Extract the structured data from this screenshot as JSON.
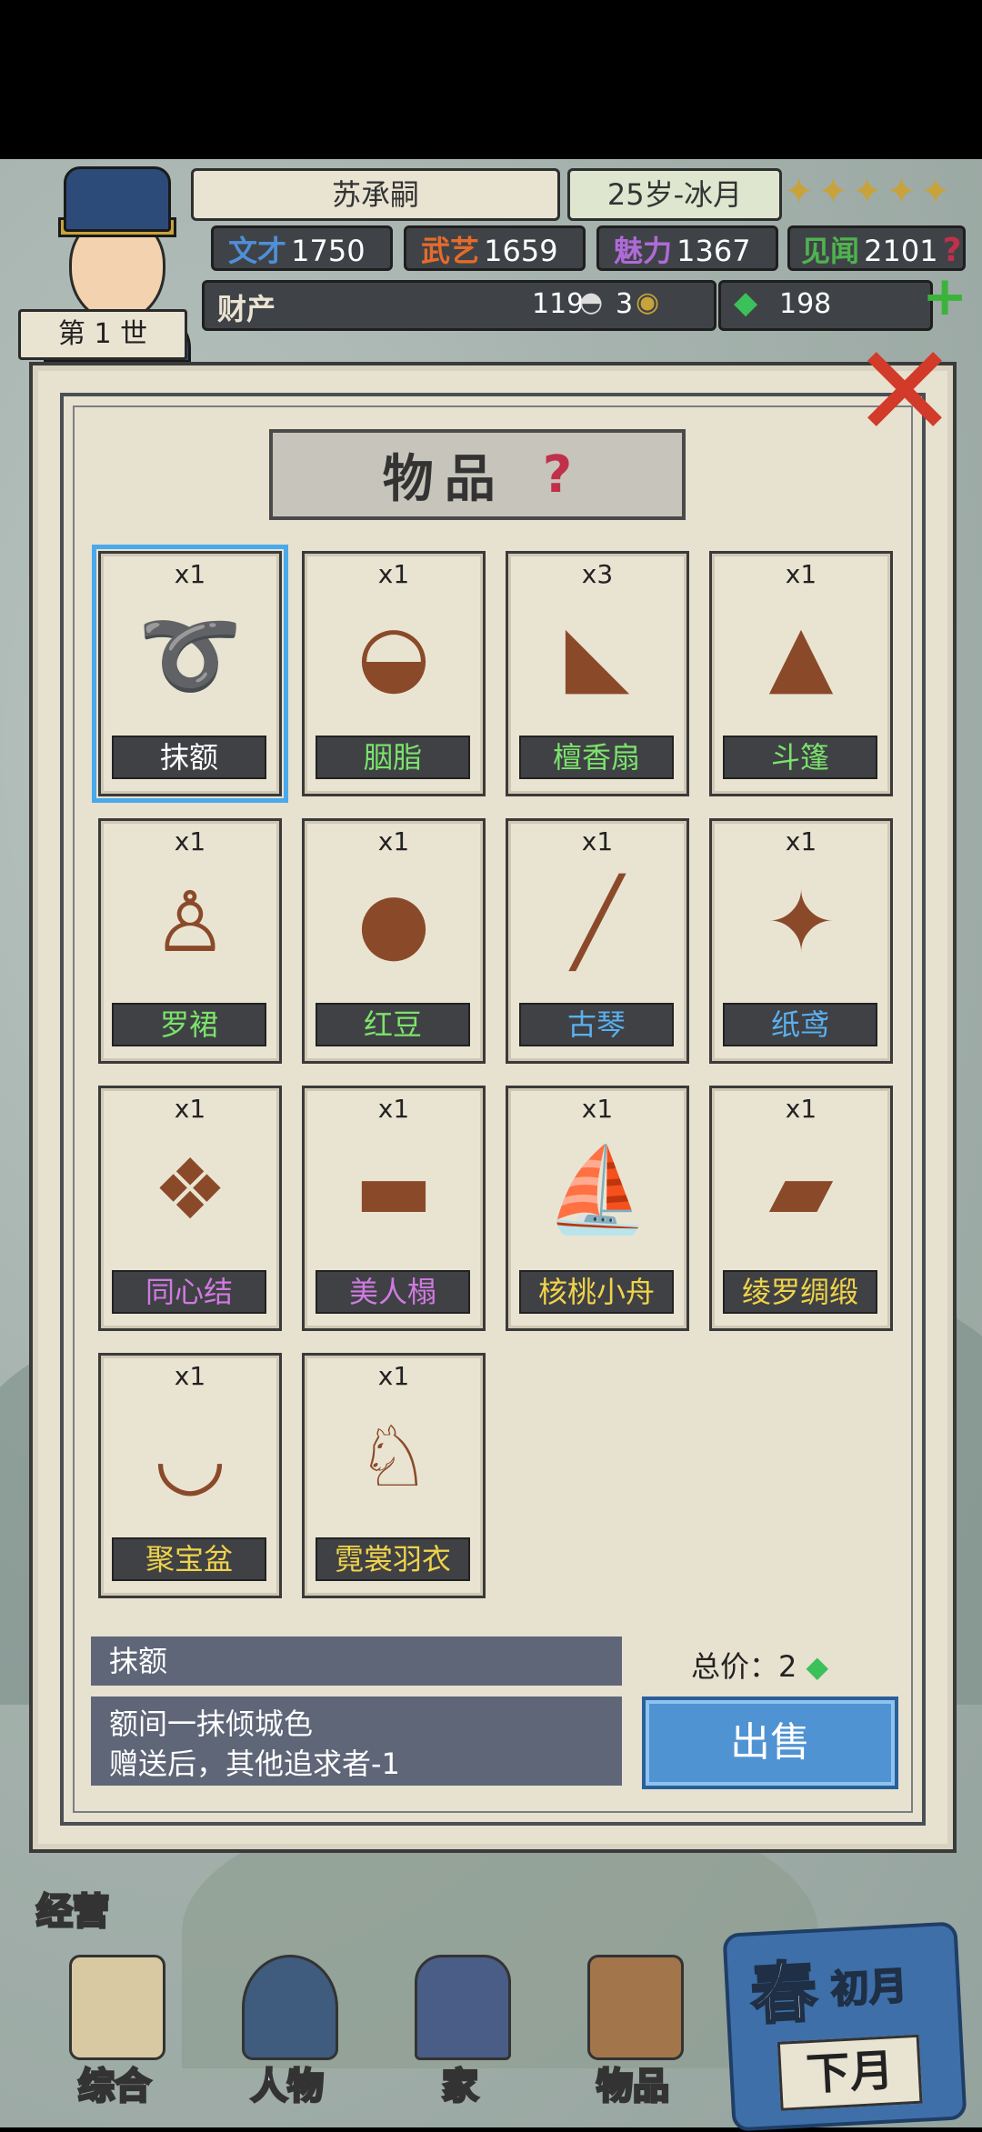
{
  "player": {
    "name": "苏承嗣",
    "age_month": "25岁-冰月",
    "generation": "第 1 世",
    "stars": [
      "✦",
      "✦",
      "✦",
      "✦",
      "✦"
    ]
  },
  "stats": [
    {
      "label": "文才",
      "value": "1750",
      "color": "#4f8fd8"
    },
    {
      "label": "武艺",
      "value": "1659",
      "color": "#e56b2a"
    },
    {
      "label": "魅力",
      "value": "1367",
      "color": "#b06ad8"
    },
    {
      "label": "见闻",
      "value": "2101",
      "color": "#4fb34f"
    }
  ],
  "wealth": {
    "label": "财产",
    "silver": "119",
    "coins": "3",
    "jade": "198"
  },
  "panel": {
    "title": "物品",
    "help": "?"
  },
  "items": [
    {
      "qty": "x1",
      "name": "抹额",
      "icon": "ribbon-headband-icon",
      "glyph": "➰",
      "name_color": "#ffffff",
      "selected": true
    },
    {
      "qty": "x1",
      "name": "胭脂",
      "icon": "rouge-box-icon",
      "glyph": "◒",
      "name_color": "#7be36b"
    },
    {
      "qty": "x3",
      "name": "檀香扇",
      "icon": "folding-fan-icon",
      "glyph": "◣",
      "name_color": "#7be36b"
    },
    {
      "qty": "x1",
      "name": "斗篷",
      "icon": "cloak-icon",
      "glyph": "▲",
      "name_color": "#7be36b"
    },
    {
      "qty": "x1",
      "name": "罗裙",
      "icon": "dress-icon",
      "glyph": "♙",
      "name_color": "#7be36b"
    },
    {
      "qty": "x1",
      "name": "红豆",
      "icon": "red-beans-sack-icon",
      "glyph": "●",
      "name_color": "#7be36b"
    },
    {
      "qty": "x1",
      "name": "古琴",
      "icon": "guqin-icon",
      "glyph": "╱",
      "name_color": "#5ab0f0"
    },
    {
      "qty": "x1",
      "name": "纸鸢",
      "icon": "kite-icon",
      "glyph": "✦",
      "name_color": "#5ab0f0"
    },
    {
      "qty": "x1",
      "name": "同心结",
      "icon": "chinese-knot-icon",
      "glyph": "❖",
      "name_color": "#d07ae0"
    },
    {
      "qty": "x1",
      "name": "美人榻",
      "icon": "daybed-icon",
      "glyph": "▬",
      "name_color": "#d07ae0"
    },
    {
      "qty": "x1",
      "name": "核桃小舟",
      "icon": "walnut-boat-icon",
      "glyph": "⛵",
      "name_color": "#f0d34a"
    },
    {
      "qty": "x1",
      "name": "绫罗绸缎",
      "icon": "silk-rolls-icon",
      "glyph": "▰",
      "name_color": "#f0d34a"
    },
    {
      "qty": "x1",
      "name": "聚宝盆",
      "icon": "treasure-bowl-icon",
      "glyph": "◡",
      "name_color": "#f0d34a"
    },
    {
      "qty": "x1",
      "name": "霓裳羽衣",
      "icon": "feather-robe-icon",
      "glyph": "♘",
      "name_color": "#f0d34a"
    }
  ],
  "detail": {
    "name": "抹额",
    "line1": "额间一抹倾城色",
    "line2": "赠送后，其他追求者-1",
    "total_label": "总价：2",
    "sell_label": "出售"
  },
  "bottom": {
    "manage_label": "经营",
    "tabs": [
      {
        "label": "综合",
        "icon": "overview-scroll-icon"
      },
      {
        "label": "人物",
        "icon": "character-icon"
      },
      {
        "label": "家",
        "icon": "house-icon"
      },
      {
        "label": "物品",
        "icon": "items-icon"
      }
    ],
    "season": "春",
    "month": "初月",
    "next_label": "下月"
  }
}
